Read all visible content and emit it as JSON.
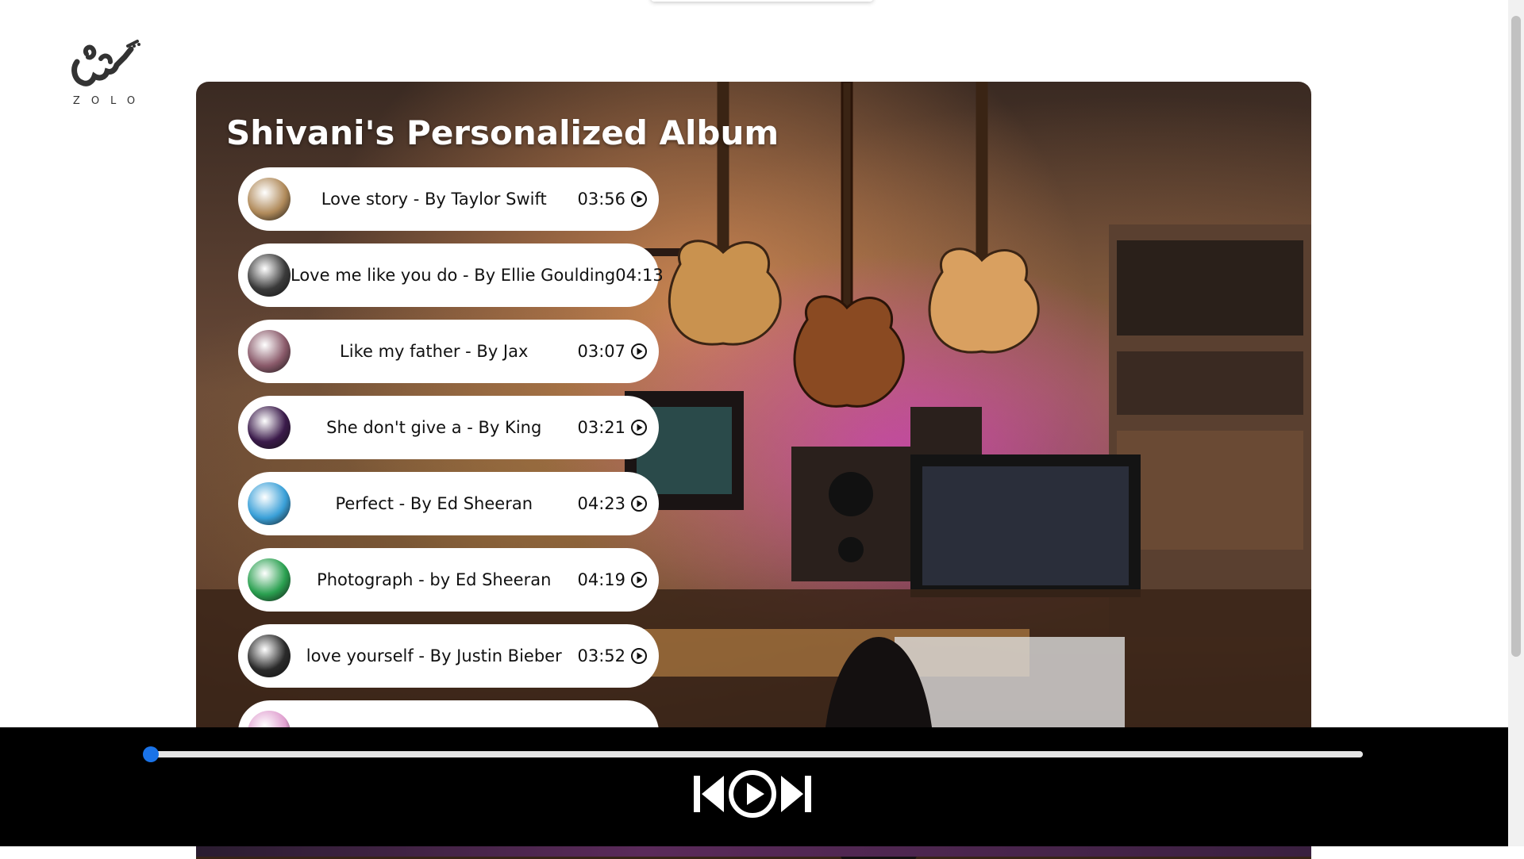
{
  "logo": {
    "text": "ZOLO"
  },
  "album": {
    "title": "Shivani's Personalized Album"
  },
  "songs": [
    {
      "title": "Love story - By Taylor Swift",
      "duration": "03:56",
      "cover": "#b08a5a"
    },
    {
      "title": "Love me like you do - By Ellie Goulding",
      "duration": "04:13",
      "cover": "#3a3a3a"
    },
    {
      "title": "Like my father - By Jax",
      "duration": "03:07",
      "cover": "#8a5a6a"
    },
    {
      "title": "She don't give a - By King",
      "duration": "03:21",
      "cover": "#3a1a4a"
    },
    {
      "title": "Perfect - By Ed Sheeran",
      "duration": "04:23",
      "cover": "#3aa0d8"
    },
    {
      "title": "Photograph - by Ed Sheeran",
      "duration": "04:19",
      "cover": "#2aa050"
    },
    {
      "title": "love yourself - By Justin Bieber",
      "duration": "03:52",
      "cover": "#2a2a2a"
    },
    {
      "title": "",
      "duration": "",
      "cover": "#e0a0d0"
    }
  ],
  "player": {
    "progress_percent": 0,
    "accent": "#1a73e8"
  },
  "icons": {
    "previous": "skip-previous-icon",
    "play": "play-circle-icon",
    "next": "skip-next-icon",
    "song_play": "play-circle-small-icon"
  }
}
